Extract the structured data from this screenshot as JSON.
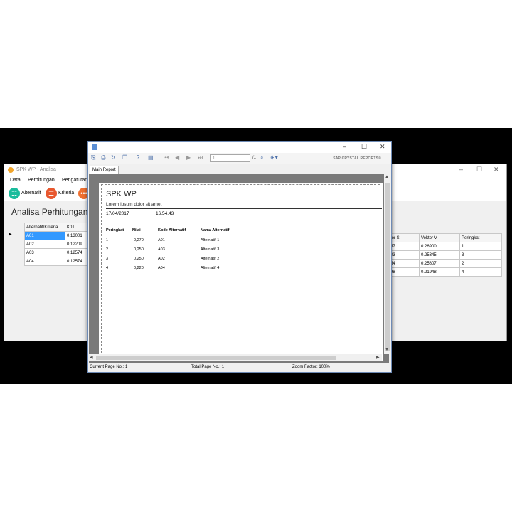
{
  "main_window": {
    "title": "SPK WP - Analisa",
    "menu": [
      "Data",
      "Perhitungan",
      "Pengaturan"
    ],
    "toolbar": [
      {
        "label": "Alternatif",
        "icon": "list-icon",
        "color": "#1abc9c"
      },
      {
        "label": "Kriteria",
        "icon": "menu-icon",
        "color": "#e8572e"
      },
      {
        "label": "",
        "icon": "more-icon",
        "color": "#f07030"
      }
    ],
    "section_title": "Analisa Perhitungan",
    "left_grid": {
      "headers": [
        "Alternatif/Kriteria",
        "K01"
      ],
      "rows": [
        [
          "A01",
          "0.13001"
        ],
        [
          "A02",
          "0.12209"
        ],
        [
          "A03",
          "0.12574"
        ],
        [
          "A04",
          "0.12574"
        ]
      ]
    },
    "right_grid": {
      "headers": [
        "tor S",
        "Vektor V",
        "Peringkat"
      ],
      "rows": [
        [
          "57",
          "0.26900",
          "1"
        ],
        [
          "03",
          "0.25345",
          "3"
        ],
        [
          "54",
          "0.25807",
          "2"
        ],
        [
          "98",
          "0.21948",
          "4"
        ]
      ]
    }
  },
  "report_window": {
    "page_input": "1",
    "page_of": "/1",
    "brand": "SAP CRYSTAL REPORTS®",
    "tab": "Main Report",
    "report": {
      "title": "SPK WP",
      "subtitle": "Lorem ipsum dolor sit amet",
      "date": "17/04/2017",
      "time": "16.54.43",
      "headers": [
        "Peringkat",
        "Nilai",
        "Kode Alternatif",
        "Nama Alternatif"
      ],
      "rows": [
        [
          "1",
          "0,270",
          "A01",
          "Alternatif 1"
        ],
        [
          "2",
          "0,250",
          "A03",
          "Alternatif 3"
        ],
        [
          "3",
          "0,250",
          "A02",
          "Alternatif 2"
        ],
        [
          "4",
          "0,220",
          "A04",
          "Alternatif 4"
        ]
      ]
    },
    "status": {
      "current_page": "Current Page No.: 1",
      "total_page": "Total Page No.: 1",
      "zoom": "Zoom Factor: 100%"
    }
  }
}
